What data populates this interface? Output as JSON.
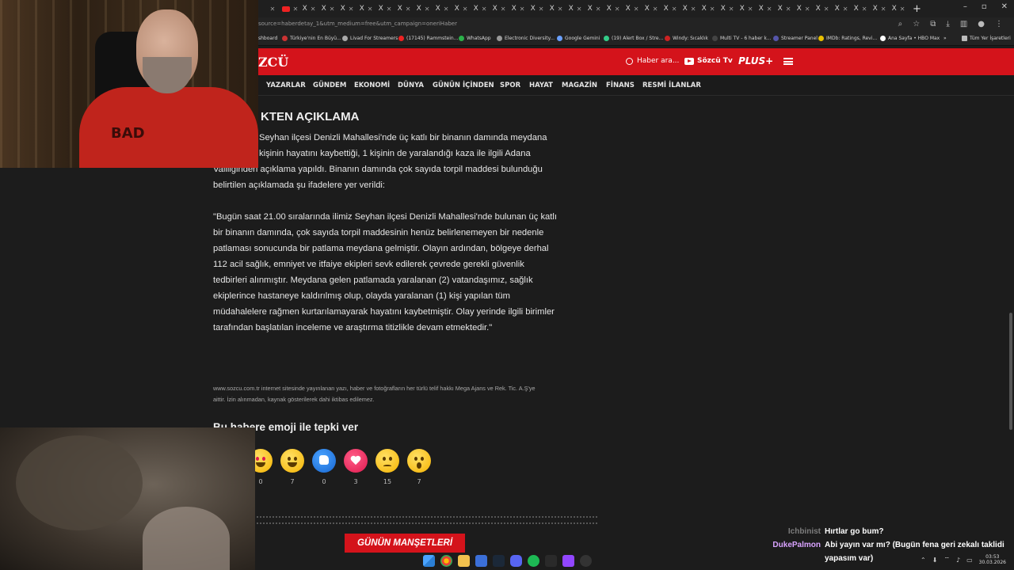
{
  "browser": {
    "url": "source=haberdetay_1&utm_medium=free&utm_campaign=oneriHaber",
    "bookmarks": [
      {
        "label": "shboard",
        "color": "#888"
      },
      {
        "label": "Türkiye'nin En Büyü...",
        "color": "#c33"
      },
      {
        "label": "Livad For Streamers",
        "color": "#aaa"
      },
      {
        "label": "(17145) Rammstein...",
        "color": "#e22"
      },
      {
        "label": "WhatsApp",
        "color": "#2bb14a"
      },
      {
        "label": "Electronic Diversity...",
        "color": "#999"
      },
      {
        "label": "Google Gemini",
        "color": "#6aa0ff"
      },
      {
        "label": "(19) Alert Box / Stre...",
        "color": "#3c8"
      },
      {
        "label": "Windy: Sıcaklık",
        "color": "#c22"
      },
      {
        "label": "Multi TV - 6 haber k...",
        "color": "#444"
      },
      {
        "label": "Streamer Panel",
        "color": "#55a"
      },
      {
        "label": "IMDb: Ratings, Revi...",
        "color": "#e8c000"
      },
      {
        "label": "Ana Sayfa • HBO Max",
        "color": "#fff"
      },
      {
        "label": "»",
        "color": "transparent"
      },
      {
        "label": "Tüm Yer İşaretleri",
        "color": "#bbb"
      }
    ]
  },
  "site": {
    "logo": "ZCÜ",
    "search_label": "Haber ara...",
    "tv_label": "Sözcü Tv",
    "plus_label": "PLUS+",
    "nav": [
      "YAZARLAR",
      "GÜNDEM",
      "EKONOMİ",
      "DÜNYA",
      "GÜNÜN İÇİNDEN",
      "SPOR",
      "HAYAT",
      "MAGAZİN",
      "FİNANS",
      "RESMİ İLANLAR"
    ]
  },
  "article": {
    "headline": "KTEN AÇIKLAMA",
    "para1": [
      "Seyhan ilçesi Denizli Mahallesi'nde üç katlı bir binanın damında meydana",
      "kişinin hayatını kaybettiği, 1 kişinin de yaralandığı kaza ile ilgili Adana",
      "Valiliğinden açıklama yapıldı. Binanın damında çok sayıda torpil maddesi bulunduğu",
      "belirtilen açıklamada şu ifadelere yer verildi:"
    ],
    "para2": [
      "\"Bugün saat 21.00 sıralarında ilimiz Seyhan ilçesi Denizli Mahallesi'nde bulunan üç katlı",
      "bir binanın damında, çok sayıda torpil maddesinin henüz belirlenemeyen bir nedenle",
      "patlaması sonucunda bir patlama meydana gelmiştir. Olayın ardından, bölgeye derhal",
      "112 acil sağlık, emniyet ve itfaiye ekipleri sevk edilerek çevrede gerekli güvenlik",
      "tedbirleri alınmıştır. Meydana gelen patlamada yaralanan (2) vatandaşımız, sağlık",
      "ekiplerince hastaneye kaldırılmış olup, olayda yaralanan (1) kişi yapılan tüm",
      "müdahalelere rağmen kurtarılamayarak hayatını kaybetmiştir. Olay yerinde ilgili birimler",
      "tarafından başlatılan inceleme ve araştırma titizlikle devam etmektedir.\""
    ],
    "copyright": [
      "www.sozcu.com.tr internet sitesinde yayınlanan yazı, haber ve fotoğrafların her türlü telif hakkı Mega Ajans ve Rek. Tic. A.Ş'ye",
      "aittir. İzin alınmadan, kaynak gösterilerek dahi iktibas edilemez."
    ],
    "emoji_title": "Bu habere emoji ile tepki ver",
    "reactions": [
      {
        "icon": "heart-eyes-icon",
        "count": "0"
      },
      {
        "icon": "laugh-icon",
        "count": "7"
      },
      {
        "icon": "thumbs-up-icon",
        "count": "0"
      },
      {
        "icon": "heart-icon",
        "count": "3"
      },
      {
        "icon": "sad-icon",
        "count": "15"
      },
      {
        "icon": "surprised-icon",
        "count": "7"
      }
    ],
    "section_banner": "GÜNÜN MANŞETLERİ"
  },
  "chat": {
    "messages": [
      {
        "user": "Ichbinist",
        "user_color": "#7d7d7d",
        "text": "Hırtlar go bum?"
      },
      {
        "user": "DukePalmon",
        "user_color": "#d9a3ff",
        "text": "Abi yayın var mı? (Bugün fena geri zekalı taklidi",
        "text2": "yapasım var)"
      }
    ]
  },
  "cam": {
    "shirt_text": "BAD"
  },
  "taskbar": {
    "time": "03:53",
    "date": "30.03.2026"
  }
}
